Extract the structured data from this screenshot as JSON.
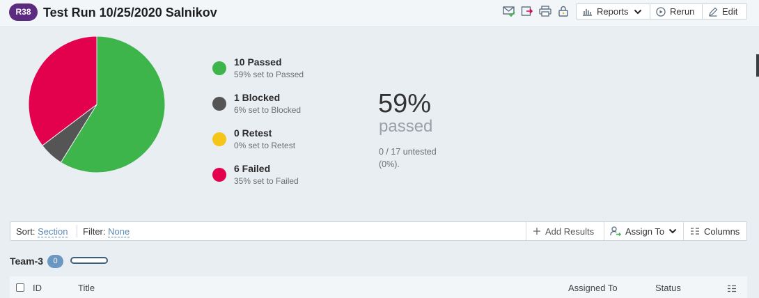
{
  "header": {
    "run_badge": "R38",
    "title": "Test Run 10/25/2020 Salnikov",
    "reports_label": "Reports",
    "rerun_label": "Rerun",
    "edit_label": "Edit"
  },
  "summary": {
    "legend": [
      {
        "label": "10 Passed",
        "sub": "59% set to Passed",
        "color": "#3db54a"
      },
      {
        "label": "1 Blocked",
        "sub": "6% set to Blocked",
        "color": "#555555"
      },
      {
        "label": "0 Retest",
        "sub": "0% set to Retest",
        "color": "#f5c518"
      },
      {
        "label": "6 Failed",
        "sub": "35% set to Failed",
        "color": "#e3004c"
      }
    ],
    "percent": "59%",
    "percent_word": "passed",
    "untested_line1": "0 / 17 untested",
    "untested_line2": "(0%)."
  },
  "chart_data": {
    "type": "pie",
    "categories": [
      "Passed",
      "Blocked",
      "Retest",
      "Failed"
    ],
    "values": [
      10,
      1,
      0,
      6
    ],
    "colors": [
      "#3db54a",
      "#555555",
      "#f5c518",
      "#e3004c"
    ]
  },
  "toolbar": {
    "sort_label": "Sort:",
    "sort_value": "Section",
    "filter_label": "Filter:",
    "filter_value": "None",
    "add_results_label": "Add Results",
    "assign_to_label": "Assign To",
    "columns_label": "Columns"
  },
  "group": {
    "name": "Team-3",
    "count": "0"
  },
  "table": {
    "columns": [
      "ID",
      "Title",
      "Assigned To",
      "Status"
    ]
  },
  "icons": {
    "badge-check": "email-check-icon",
    "export": "export-icon",
    "print": "print-icon",
    "lock": "lock-icon"
  }
}
